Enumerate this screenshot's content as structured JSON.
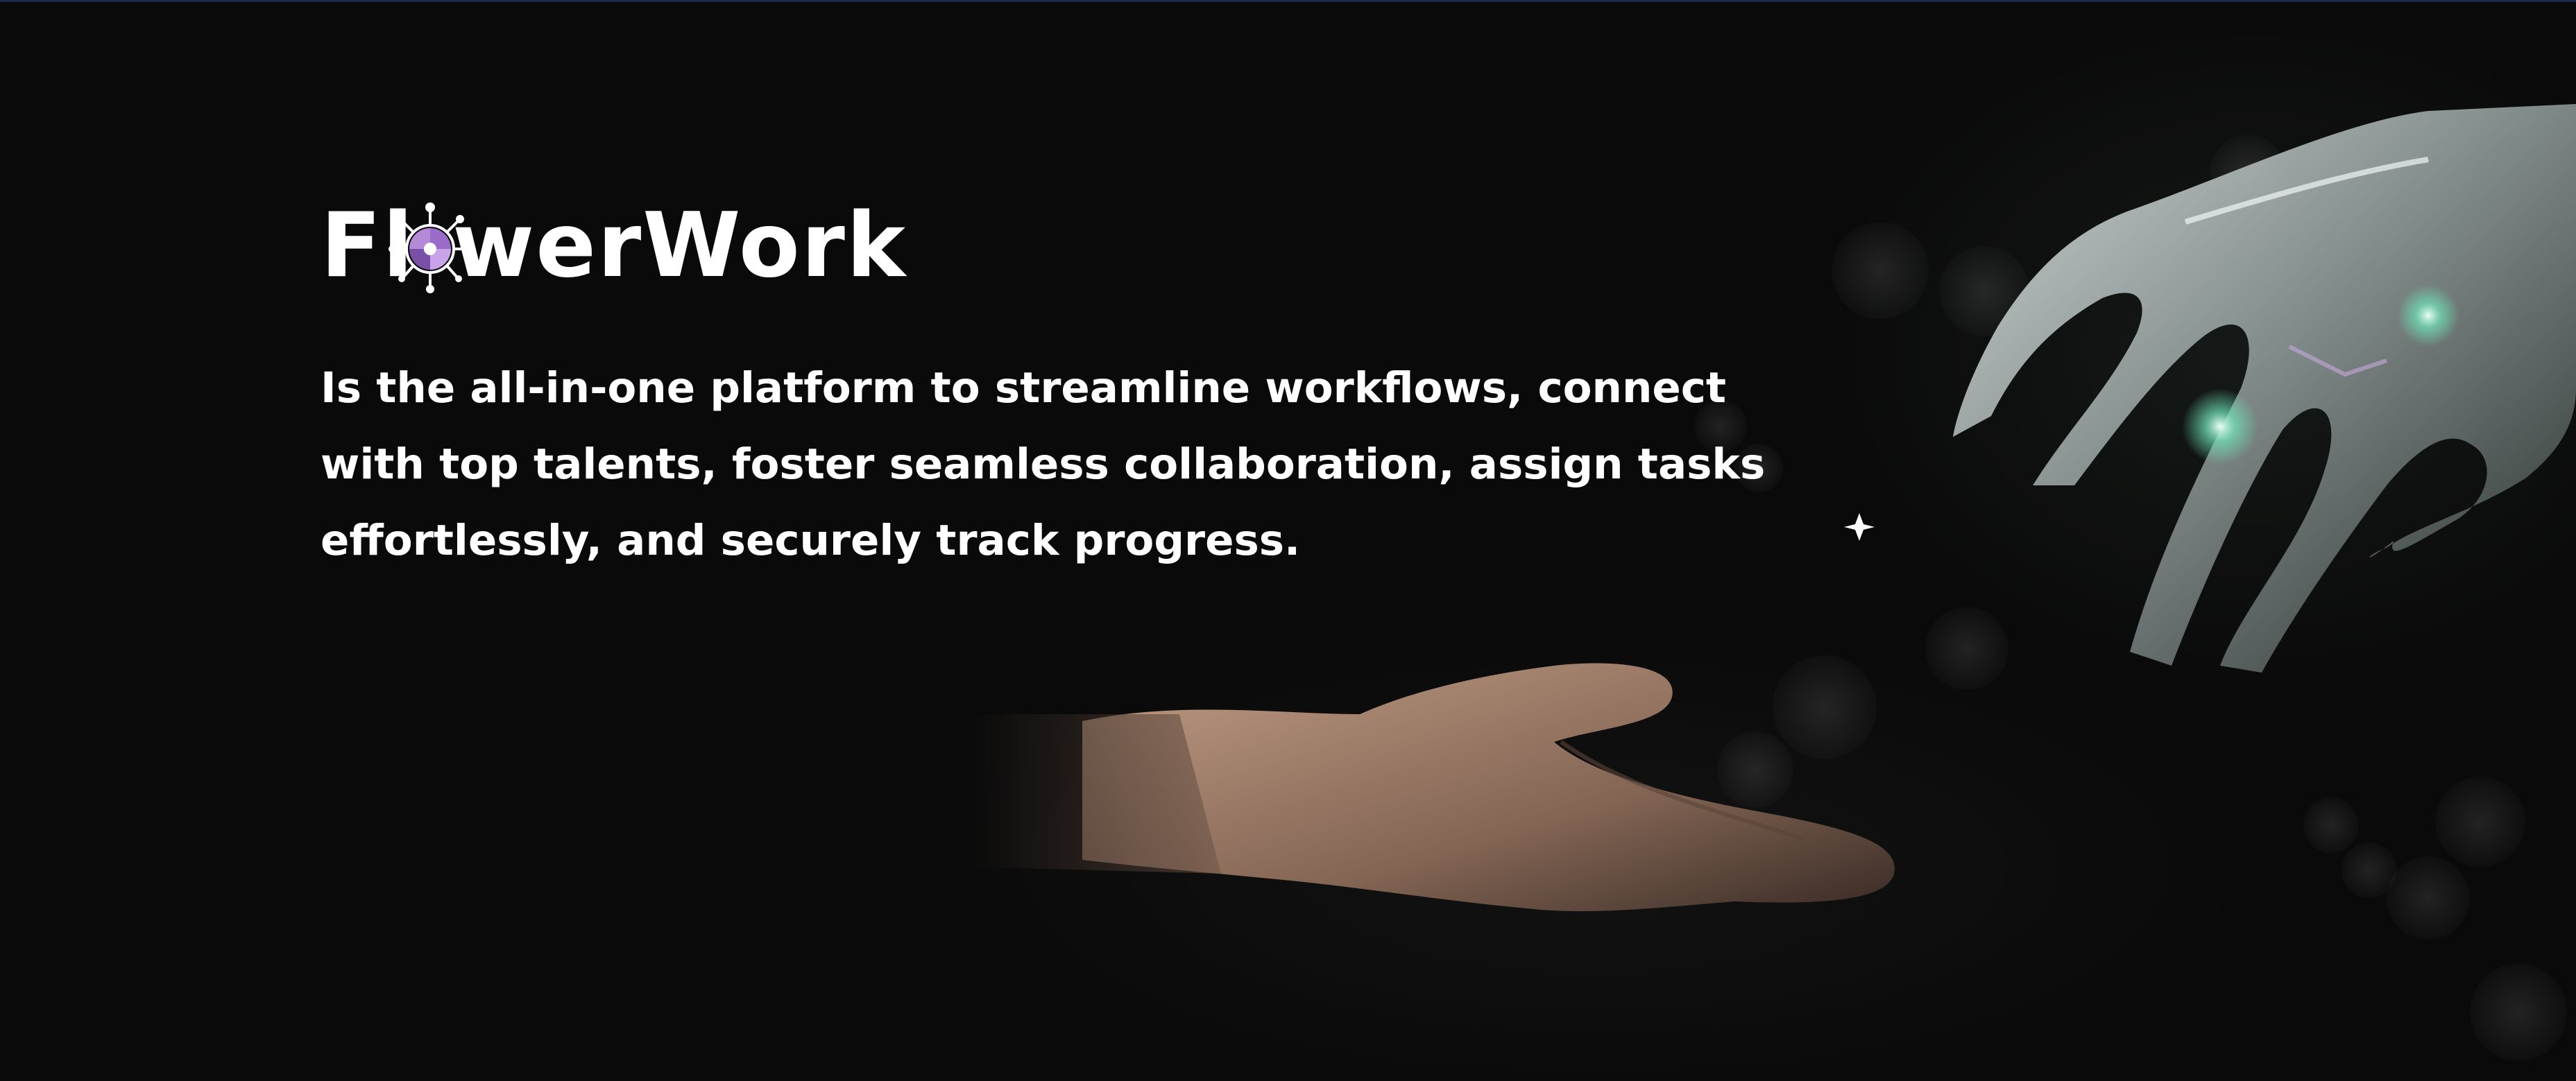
{
  "brand": {
    "logo_text_start": "Fl",
    "logo_text_end": "werWork",
    "logo_icon": "flower-network-icon",
    "accent_color": "#9b6bc9"
  },
  "hero": {
    "tagline": "Is the all-in-one platform to streamline workflows, connect with top talents, foster seamless collaboration, assign tasks effortlessly, and securely track progress."
  },
  "colors": {
    "background": "#0a0a0a",
    "text": "#ffffff",
    "robot_glow": "#6fe3b8"
  }
}
